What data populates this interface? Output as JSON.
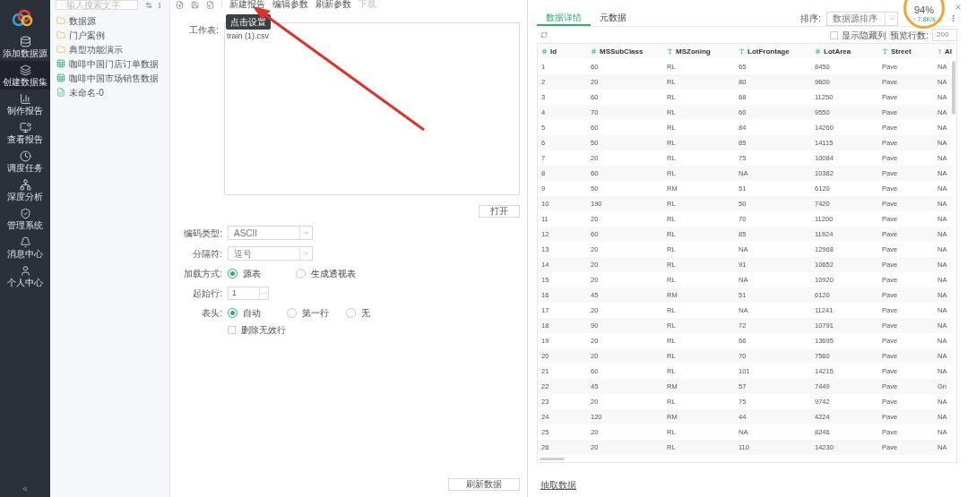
{
  "sidebar": {
    "items": [
      {
        "label": "添加数据源",
        "selected": false
      },
      {
        "label": "创建数据集",
        "selected": true
      },
      {
        "label": "制作报告",
        "selected": false
      },
      {
        "label": "查看报告",
        "selected": false
      },
      {
        "label": "调度任务",
        "selected": false
      },
      {
        "label": "深度分析",
        "selected": false
      },
      {
        "label": "管理系统",
        "selected": false
      },
      {
        "label": "消息中心",
        "selected": false
      },
      {
        "label": "个人中心",
        "selected": false
      }
    ],
    "collapse": "«"
  },
  "tree": {
    "search": {
      "placeholder": "输入搜索文字"
    },
    "items": [
      {
        "label": "数据源",
        "kind": "folder"
      },
      {
        "label": "门户案例",
        "kind": "folder"
      },
      {
        "label": "典型功能演示",
        "kind": "folder"
      },
      {
        "label": "咖啡中国门店订单数据",
        "kind": "dataset"
      },
      {
        "label": "咖啡中国市场销售数据",
        "kind": "dataset"
      },
      {
        "label": "未命名-0",
        "kind": "draft"
      }
    ]
  },
  "toolbar": {
    "items": [
      {
        "label": "新建报告",
        "disabled": false
      },
      {
        "label": "编辑参数",
        "disabled": false
      },
      {
        "label": "刷新参数",
        "disabled": false
      },
      {
        "label": "下载",
        "disabled": true
      }
    ],
    "tooltip": "点击设置"
  },
  "form": {
    "sheet_label": "工作表:",
    "sheet_value": "train (1).csv",
    "open_button": "打开",
    "encoding": {
      "label": "编码类型:",
      "value": "ASCII"
    },
    "separator": {
      "label": "分隔符:",
      "value": "逗号"
    },
    "load_mode": {
      "label": "加载方式:",
      "options": [
        {
          "label": "源表",
          "selected": true
        },
        {
          "label": "生成透视表",
          "selected": false
        }
      ]
    },
    "start_row": {
      "label": "起始行:",
      "value": "1"
    },
    "header": {
      "label": "表头:",
      "options": [
        {
          "label": "自动",
          "selected": true
        },
        {
          "label": "第一行",
          "selected": false
        },
        {
          "label": "无",
          "selected": false
        }
      ]
    },
    "remove_invalid": {
      "label": "删除无效行",
      "checked": false
    },
    "refresh_button": "刷新数据"
  },
  "preview": {
    "tabs": [
      {
        "label": "数据详情",
        "selected": true
      },
      {
        "label": "元数据",
        "selected": false
      }
    ],
    "sort": {
      "label": "排序:",
      "value": "数据源排序"
    },
    "show_hidden": {
      "label": "显示隐藏列",
      "checked": false
    },
    "preview_rows": {
      "label": "预览行数:",
      "value": "200"
    },
    "table": {
      "columns": [
        {
          "label": "Id",
          "kind": "number"
        },
        {
          "label": "MSSubClass",
          "kind": "number"
        },
        {
          "label": "MSZoning",
          "kind": "text"
        },
        {
          "label": "LotFrontage",
          "kind": "text"
        },
        {
          "label": "LotArea",
          "kind": "number"
        },
        {
          "label": "Street",
          "kind": "text"
        },
        {
          "label": "Al",
          "kind": "text"
        }
      ],
      "rows": [
        [
          "1",
          "60",
          "RL",
          "65",
          "8450",
          "Pave",
          "NA"
        ],
        [
          "2",
          "20",
          "RL",
          "80",
          "9600",
          "Pave",
          "NA"
        ],
        [
          "3",
          "60",
          "RL",
          "68",
          "11250",
          "Pave",
          "NA"
        ],
        [
          "4",
          "70",
          "RL",
          "60",
          "9550",
          "Pave",
          "NA"
        ],
        [
          "5",
          "60",
          "RL",
          "84",
          "14260",
          "Pave",
          "NA"
        ],
        [
          "6",
          "50",
          "RL",
          "85",
          "14115",
          "Pave",
          "NA"
        ],
        [
          "7",
          "20",
          "RL",
          "75",
          "10084",
          "Pave",
          "NA"
        ],
        [
          "8",
          "60",
          "RL",
          "NA",
          "10382",
          "Pave",
          "NA"
        ],
        [
          "9",
          "50",
          "RM",
          "51",
          "6120",
          "Pave",
          "NA"
        ],
        [
          "10",
          "190",
          "RL",
          "50",
          "7420",
          "Pave",
          "NA"
        ],
        [
          "11",
          "20",
          "RL",
          "70",
          "11200",
          "Pave",
          "NA"
        ],
        [
          "12",
          "60",
          "RL",
          "85",
          "11924",
          "Pave",
          "NA"
        ],
        [
          "13",
          "20",
          "RL",
          "NA",
          "12968",
          "Pave",
          "NA"
        ],
        [
          "14",
          "20",
          "RL",
          "91",
          "10652",
          "Pave",
          "NA"
        ],
        [
          "15",
          "20",
          "RL",
          "NA",
          "10920",
          "Pave",
          "NA"
        ],
        [
          "16",
          "45",
          "RM",
          "51",
          "6120",
          "Pave",
          "NA"
        ],
        [
          "17",
          "20",
          "RL",
          "NA",
          "11241",
          "Pave",
          "NA"
        ],
        [
          "18",
          "90",
          "RL",
          "72",
          "10791",
          "Pave",
          "NA"
        ],
        [
          "19",
          "20",
          "RL",
          "66",
          "13695",
          "Pave",
          "NA"
        ],
        [
          "20",
          "20",
          "RL",
          "70",
          "7560",
          "Pave",
          "NA"
        ],
        [
          "21",
          "60",
          "RL",
          "101",
          "14215",
          "Pave",
          "NA"
        ],
        [
          "22",
          "45",
          "RM",
          "57",
          "7449",
          "Pave",
          "Gn"
        ],
        [
          "23",
          "20",
          "RL",
          "75",
          "9742",
          "Pave",
          "NA"
        ],
        [
          "24",
          "120",
          "RM",
          "44",
          "4224",
          "Pave",
          "NA"
        ],
        [
          "25",
          "20",
          "RL",
          "NA",
          "8246",
          "Pave",
          "NA"
        ],
        [
          "26",
          "20",
          "RL",
          "110",
          "14230",
          "Pave",
          "NA"
        ]
      ]
    },
    "extract_link": "抽取数据"
  },
  "speed_widget": {
    "percent": "94%",
    "rate": "↑ 7.8K/s"
  }
}
